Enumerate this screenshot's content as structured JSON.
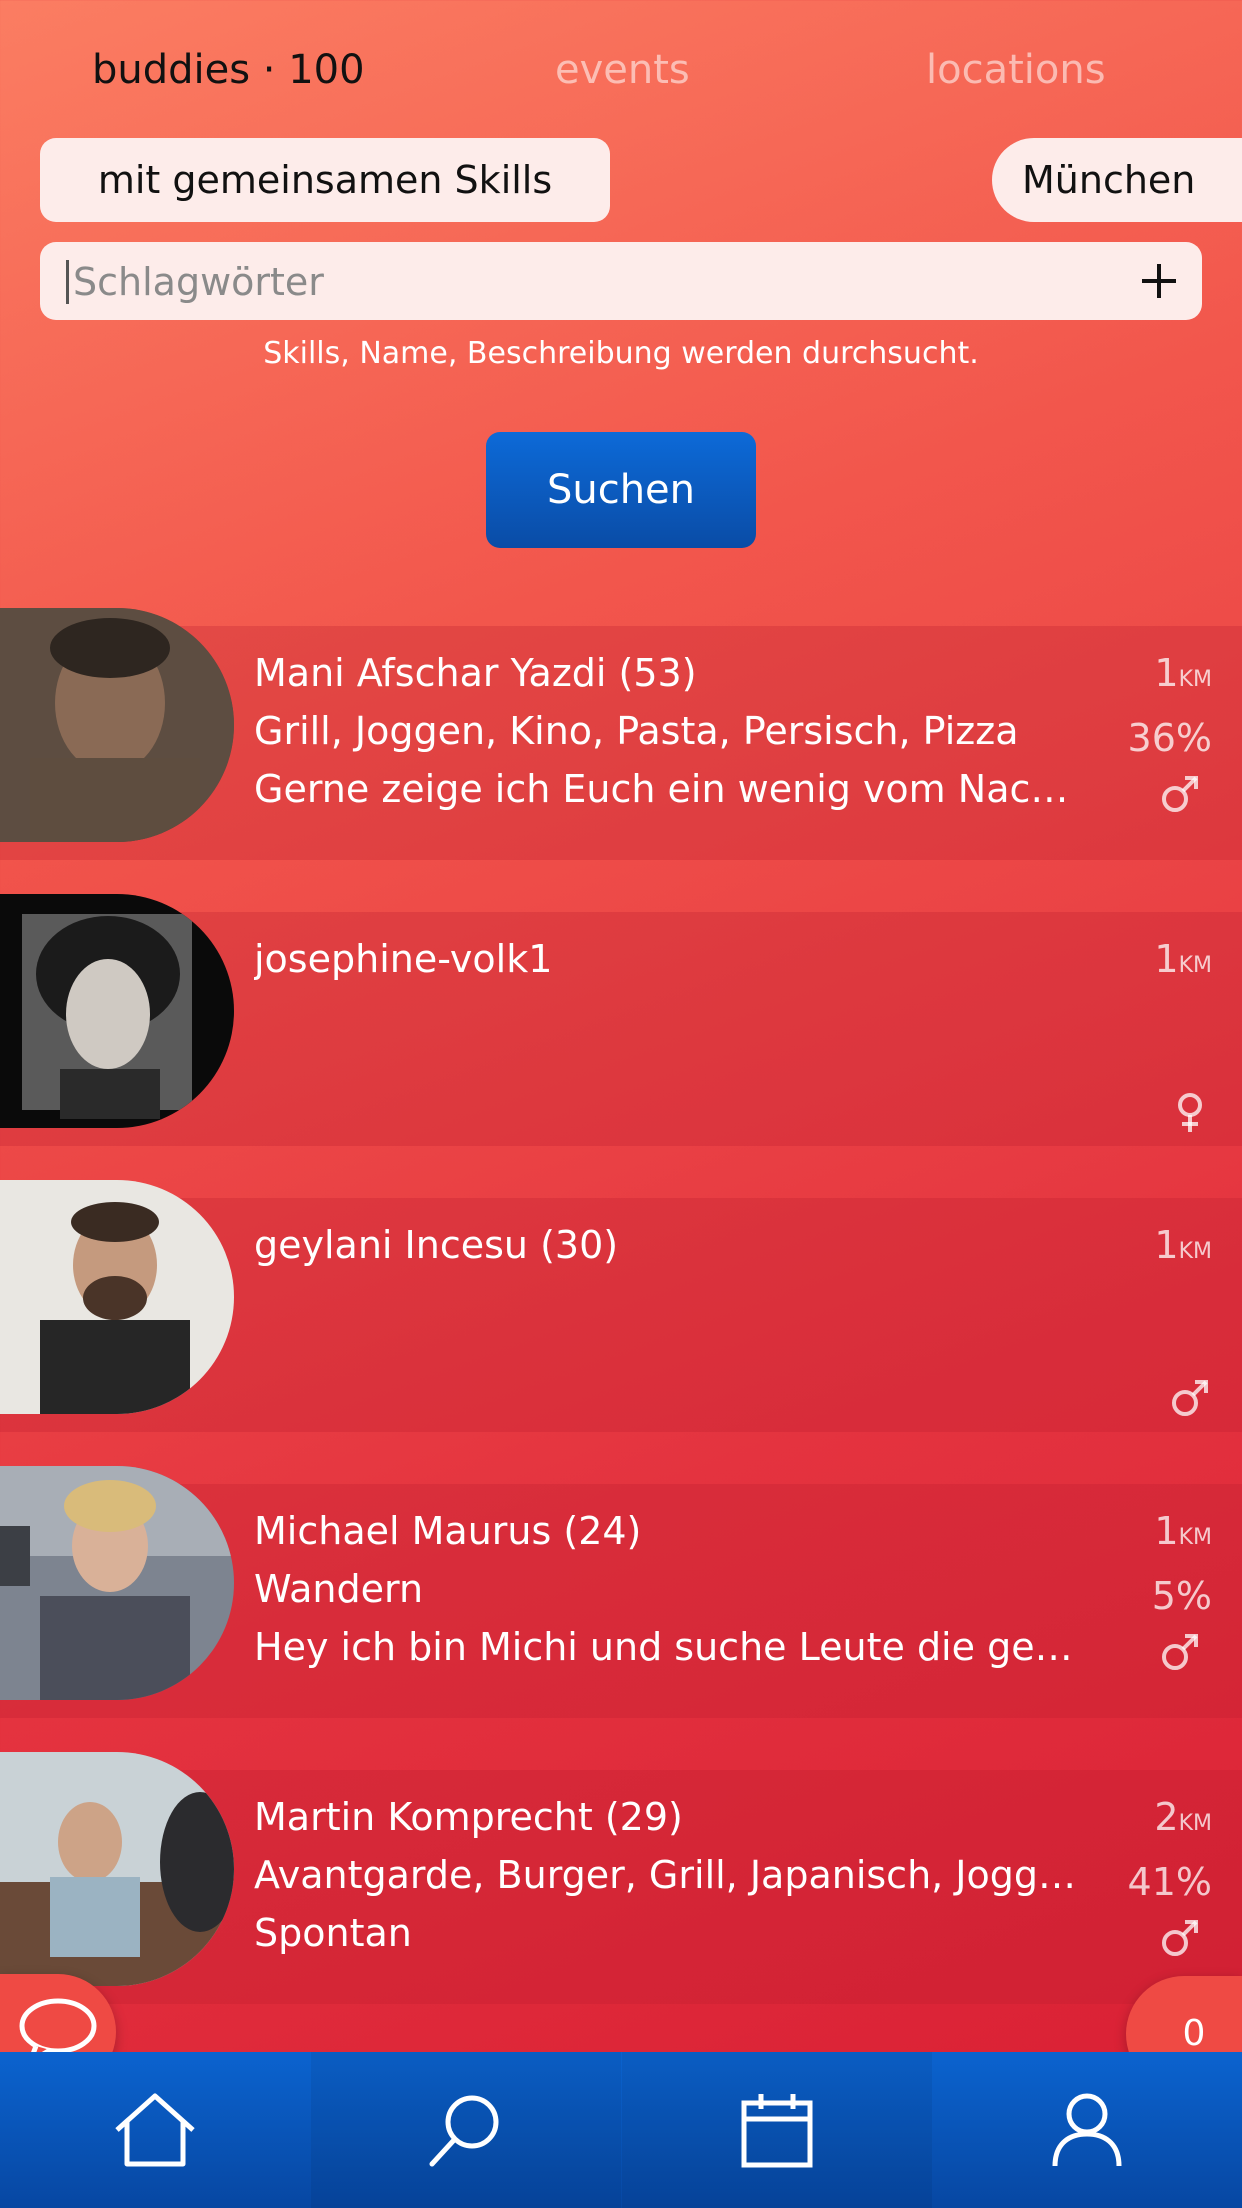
{
  "tabs": {
    "buddies": "buddies · 100",
    "events": "events",
    "locations": "locations"
  },
  "filters": {
    "skills": "mit gemeinsamen Skills",
    "city": "München"
  },
  "search": {
    "placeholder": "Schlagwörter",
    "hint": "Skills, Name, Beschreibung werden durchsucht.",
    "button": "Suchen"
  },
  "buddies": [
    {
      "name": "Mani Afschar Yazdi (53)",
      "skills": "Grill, Joggen, Kino, Pasta, Persisch, Pizza",
      "description": "Gerne zeige ich Euch ein wenig vom Nachtleben",
      "distance": "1",
      "unit": "KM",
      "match": "36%",
      "gender": "male-icon"
    },
    {
      "name": "josephine-volk1",
      "skills": "",
      "description": "",
      "distance": "1",
      "unit": "KM",
      "match": "",
      "gender": "female-icon"
    },
    {
      "name": "geylani Incesu (30)",
      "skills": "",
      "description": "",
      "distance": "1",
      "unit": "KM",
      "match": "",
      "gender": "male-icon"
    },
    {
      "name": "Michael Maurus (24)",
      "skills": "Wandern",
      "description": "Hey ich bin Michi und suche Leute die gerne",
      "distance": "1",
      "unit": "KM",
      "match": "5%",
      "gender": "male-icon"
    },
    {
      "name": "Martin Komprecht (29)",
      "skills": "Avantgarde, Burger, Grill, Japanisch, Joggen",
      "description": "Spontan",
      "distance": "2",
      "unit": "KM",
      "match": "41%",
      "gender": "male-icon"
    }
  ],
  "fabs": {
    "count": "0"
  },
  "colors": {
    "accent_blue": "#0a5bc2",
    "background_top": "#fb7d62",
    "background_bottom": "#d81d33"
  }
}
